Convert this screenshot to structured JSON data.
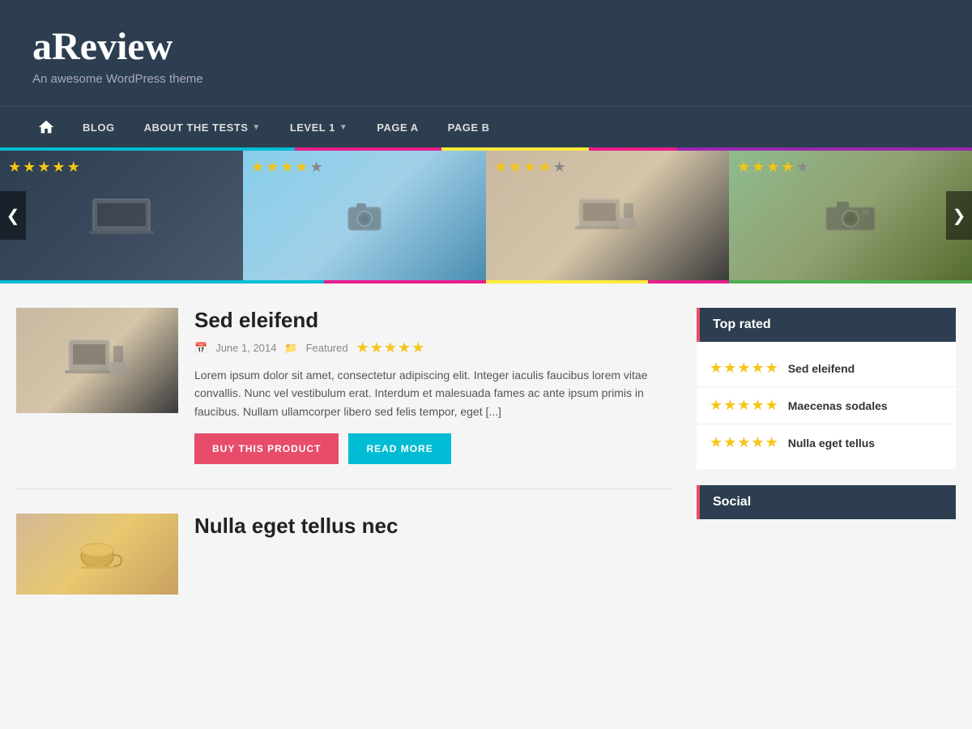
{
  "site": {
    "title": "aReview",
    "subtitle": "An awesome WordPress theme"
  },
  "nav": {
    "home_icon": "⌂",
    "items": [
      {
        "label": "BLOG",
        "has_arrow": false
      },
      {
        "label": "ABOUT THE TESTS",
        "has_arrow": true
      },
      {
        "label": "LEVEL 1",
        "has_arrow": true
      },
      {
        "label": "PAGE A",
        "has_arrow": false
      },
      {
        "label": "PAGE B",
        "has_arrow": false
      }
    ]
  },
  "slider": {
    "prev_label": "❮",
    "next_label": "❯",
    "slides": [
      {
        "stars": 4.5,
        "alt": "Laptop on desk"
      },
      {
        "stars": 3.5,
        "alt": "Camera in hand"
      },
      {
        "stars": 3.5,
        "alt": "Laptop and stationery"
      },
      {
        "stars": 4,
        "alt": "Film camera outdoor"
      }
    ]
  },
  "posts": [
    {
      "title": "Sed eleifend",
      "date": "June 1, 2014",
      "category": "Featured",
      "stars": 4.5,
      "excerpt": "Lorem ipsum dolor sit amet, consectetur adipiscing elit. Integer iaculis faucibus lorem vitae convallis. Nunc vel vestibulum erat. Interdum et malesuada fames ac ante ipsum primis in faucibus. Nullam ullamcorper libero sed felis tempor, eget [...]",
      "btn_buy": "BUY THIS PRODUCT",
      "btn_read": "READ MORE"
    },
    {
      "title": "Nulla eget tellus nec",
      "date": "",
      "category": "",
      "stars": 0,
      "excerpt": ""
    }
  ],
  "sidebar": {
    "top_rated_title": "Top rated",
    "top_rated_items": [
      {
        "title": "Sed eleifend",
        "stars": 4.5
      },
      {
        "title": "Maecenas sodales",
        "stars": 4.5
      },
      {
        "title": "Nulla eget tellus",
        "stars": 4.5
      }
    ],
    "social_title": "Social"
  }
}
